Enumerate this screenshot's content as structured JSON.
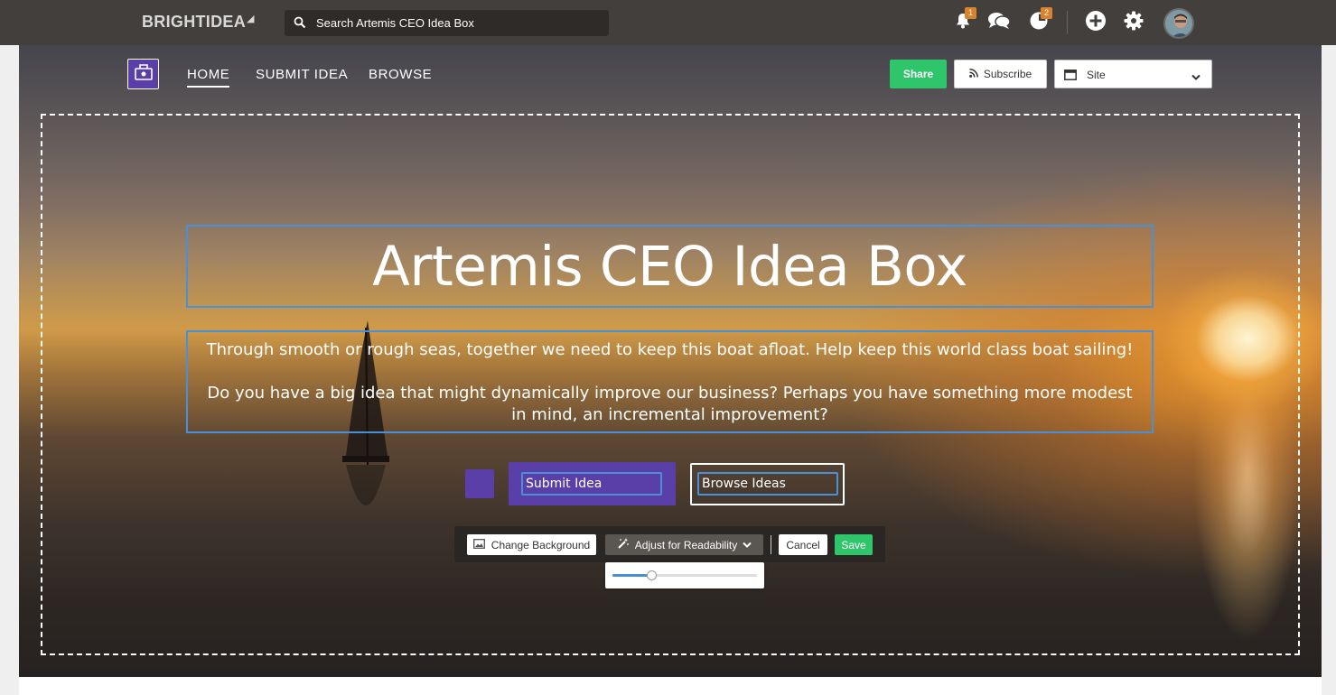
{
  "topbar": {
    "brand": "BRIGHTIDEA",
    "brand_mark": "◢",
    "search": {
      "placeholder": "Search Artemis CEO Idea Box",
      "icon": "search-icon"
    },
    "notifications": {
      "icon": "bell-icon",
      "badge": "1"
    },
    "messages": {
      "icon": "chat-icon"
    },
    "activity": {
      "icon": "clock-pie-icon",
      "badge": "2"
    },
    "add": {
      "icon": "plus-circle-icon"
    },
    "settings": {
      "icon": "gear-icon"
    },
    "avatar": {
      "icon": "user-avatar"
    }
  },
  "nav": {
    "logo_icon": "idea-box-logo-icon",
    "items": [
      {
        "label": "HOME",
        "active": true
      },
      {
        "label": "SUBMIT IDEA",
        "active": false
      },
      {
        "label": "BROWSE",
        "active": false
      }
    ]
  },
  "actions": {
    "share_label": "Share",
    "subscribe_label": "Subscribe",
    "subscribe_icon": "rss-icon",
    "site_select": {
      "value": "Site",
      "icon": "window-icon"
    }
  },
  "hero": {
    "title": "Artemis CEO Idea Box",
    "description": [
      "Through smooth or rough seas, together we need to keep this boat afloat. Help keep this world class boat sailing!",
      "Do you have a big idea that might dynamically improve our business? Perhaps you have something more modest in mind, an incremental improvement?"
    ],
    "submit_button": "Submit Idea",
    "browse_button": "Browse Ideas",
    "swatch_color": "#5a3fa8"
  },
  "editor_toolbar": {
    "change_background": "Change Background",
    "change_background_icon": "image-icon",
    "adjust_readability": "Adjust for Readability",
    "adjust_icon": "magic-wand-icon",
    "cancel": "Cancel",
    "save": "Save",
    "readability_level": 0.27
  },
  "colors": {
    "accent_purple": "#5a3fa8",
    "share_green": "#2fc56b",
    "focus_blue": "#4a90d9",
    "badge_orange": "#d9822b",
    "topbar_bg": "#433f3c"
  }
}
